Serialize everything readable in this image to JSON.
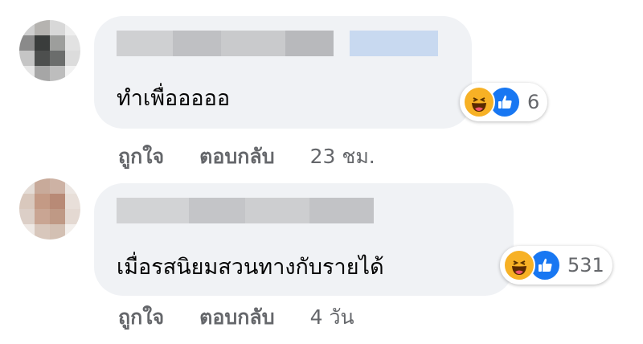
{
  "comments": [
    {
      "text": "ทำเพื่อออออ",
      "reaction_count": "6",
      "reaction_icons": [
        "haha-icon",
        "like-icon"
      ],
      "actions": {
        "like": "ถูกใจ",
        "reply": "ตอบกลับ",
        "time": "23 ชม."
      }
    },
    {
      "text": "เมื่อรสนิยมสวนทางกับรายได้",
      "reaction_count": "531",
      "reaction_icons": [
        "haha-icon",
        "like-icon"
      ],
      "actions": {
        "like": "ถูกใจ",
        "reply": "ตอบกลับ",
        "time": "4 วัน"
      }
    }
  ],
  "colors": {
    "bubble_bg": "#f0f2f5",
    "meta_text": "#65676b",
    "like_blue": "#1877f2",
    "haha_yellow": "#f7b125"
  }
}
